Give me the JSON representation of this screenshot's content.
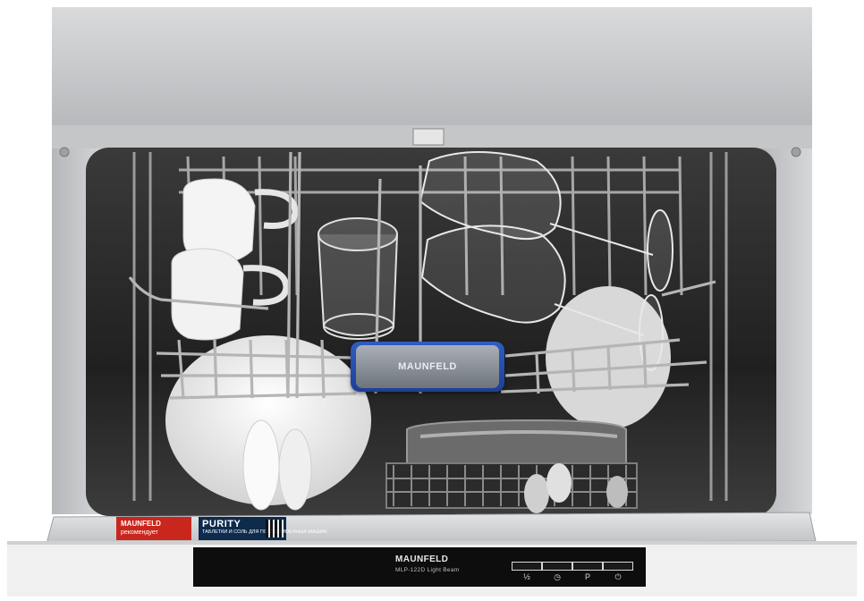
{
  "handle": {
    "logo": "MAUNFELD"
  },
  "sticker_brand": {
    "brand": "MAUNFELD",
    "sub": "рекомендует"
  },
  "sticker_purity": {
    "title": "PURITY",
    "sub": "ТАБЛЕТКИ И СОЛЬ ДЛЯ ПОСУДОМОЕЧНЫХ МАШИН"
  },
  "panel": {
    "logo": "MAUNFELD",
    "model": "MLP-122D Light Beam",
    "buttons": [
      {
        "label": "½",
        "icon": "half-load-icon"
      },
      {
        "label": "◷",
        "icon": "clock-icon"
      },
      {
        "label": "P",
        "icon": "program-icon"
      },
      {
        "label": "⏻",
        "icon": "power-icon"
      }
    ]
  },
  "colors": {
    "steel": "#c9cacc",
    "interior": "#2b2b2b",
    "handle_blue": "#2a54b8",
    "sticker_red": "#c9271e",
    "panel_black": "#0d0d0d"
  }
}
